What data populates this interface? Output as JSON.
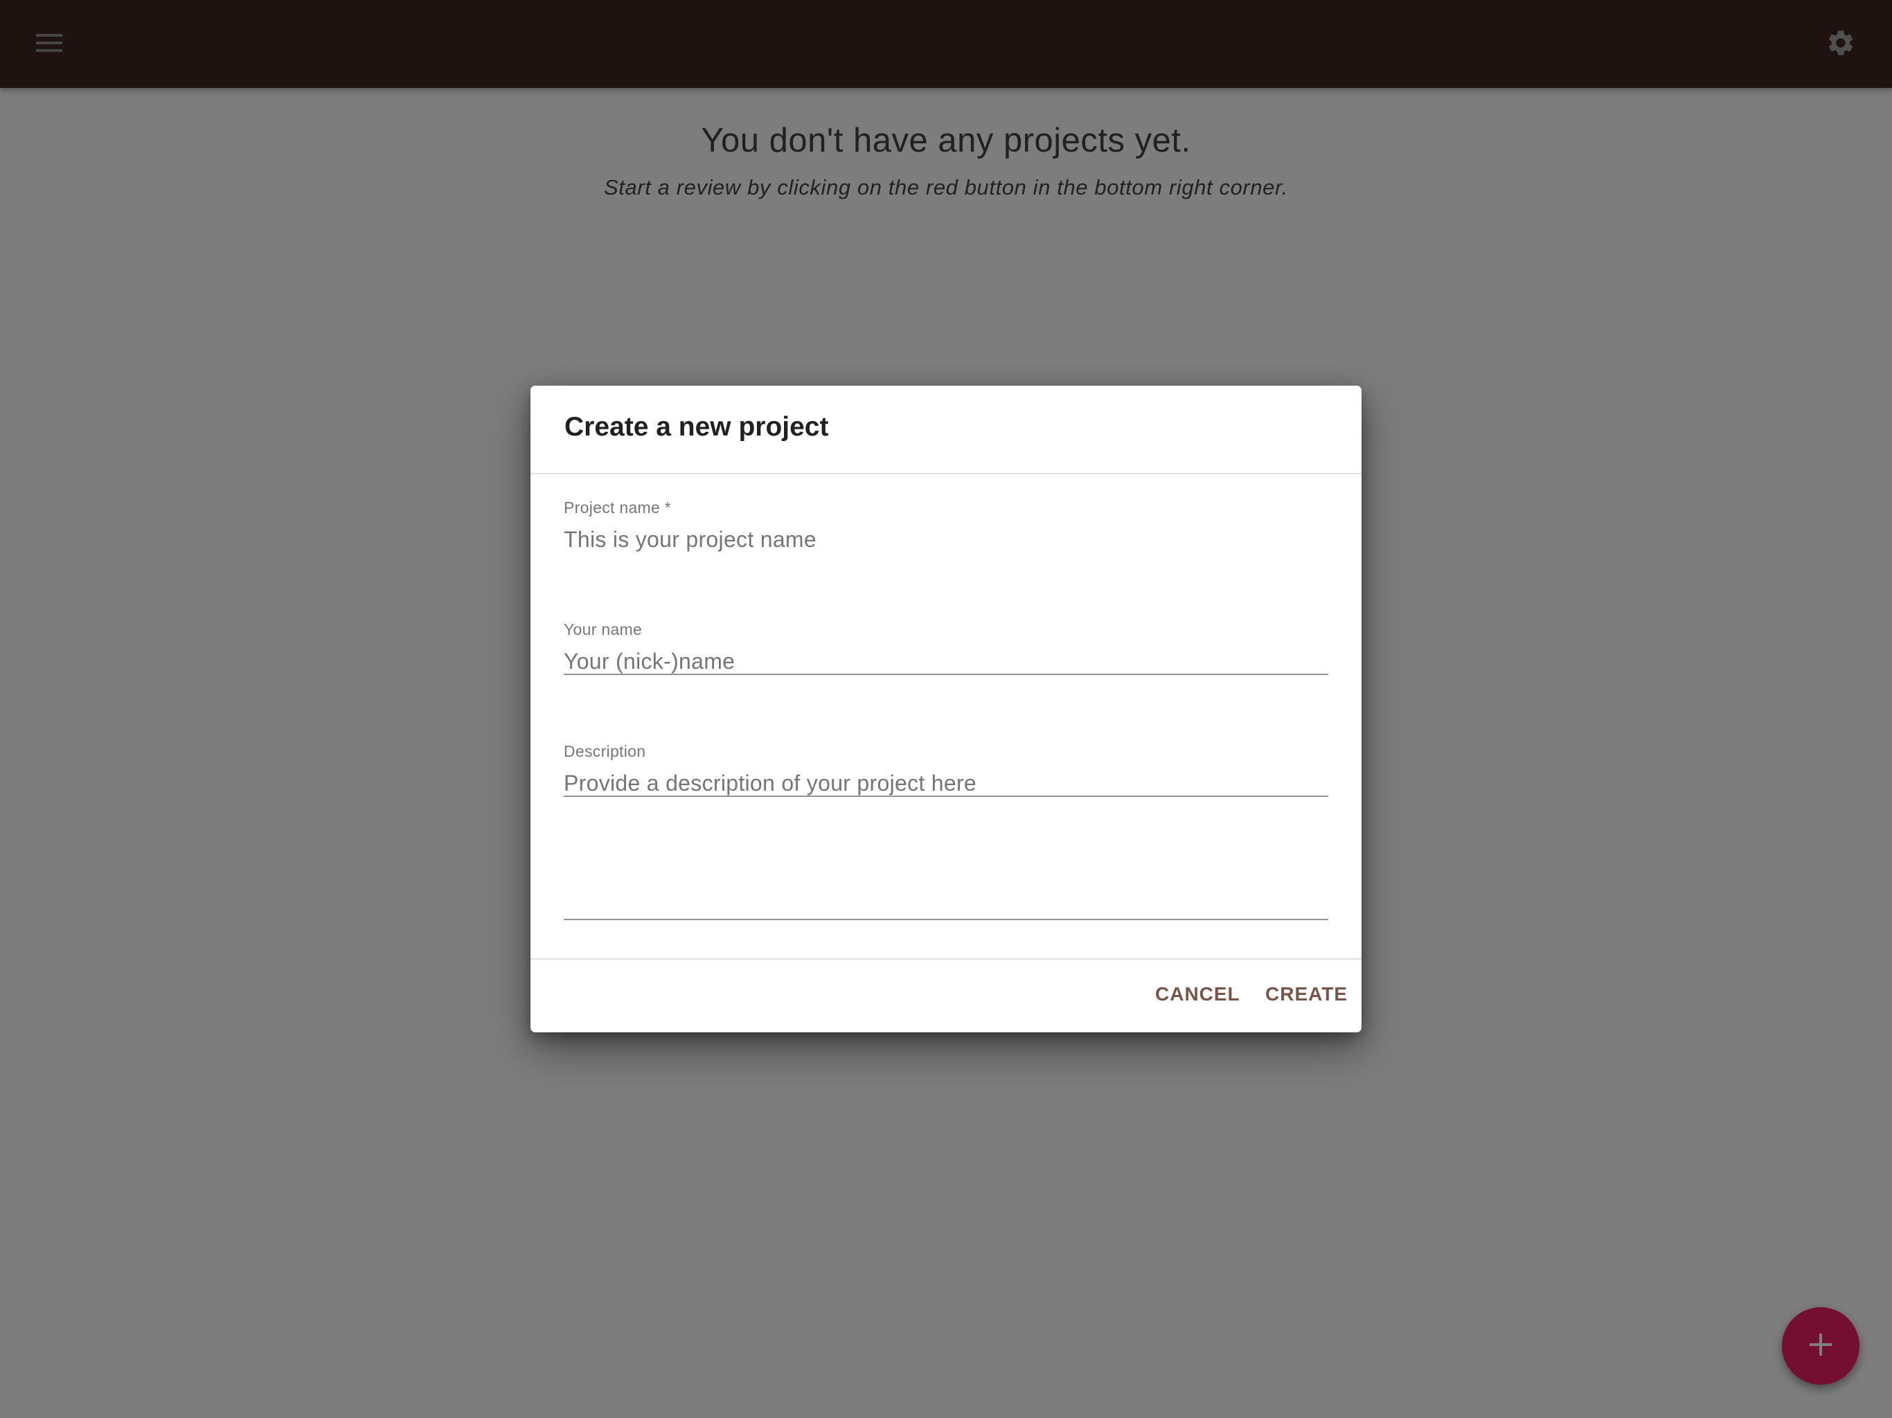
{
  "header": {
    "menu_icon": "menu-icon",
    "settings_icon": "gear-icon",
    "background_color": "#3e2723"
  },
  "empty_state": {
    "title": "You don't have any projects yet.",
    "subtitle": "Start a review by clicking on the red button in the bottom right corner."
  },
  "fab": {
    "icon": "plus-icon",
    "color": "#e91e63"
  },
  "dialog": {
    "title": "Create a new project",
    "fields": {
      "project_name": {
        "label": "Project name *",
        "placeholder": "This is your project name",
        "value": ""
      },
      "your_name": {
        "label": "Your name",
        "placeholder": "Your (nick-)name",
        "value": ""
      },
      "description": {
        "label": "Description",
        "placeholder": "Provide a description of your project here",
        "value": ""
      }
    },
    "actions": {
      "cancel_label": "CANCEL",
      "create_label": "CREATE",
      "color": "#795548"
    }
  }
}
